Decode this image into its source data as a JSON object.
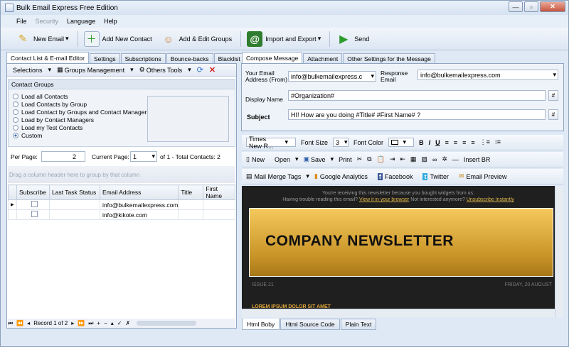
{
  "window": {
    "title": "Bulk Email Express Free Edition",
    "minimize": "—",
    "maximize": "▫",
    "close": "✕"
  },
  "menu": {
    "file": "File",
    "security": "Security",
    "language": "Language",
    "help": "Help"
  },
  "toolbar": {
    "new_email": "New Email",
    "add_contact": "Add New Contact",
    "add_groups": "Add & Edit Groups",
    "import_export": "Import and Export",
    "send": "Send"
  },
  "left_tabs": [
    "Contact List & E-mail Editor",
    "Settings",
    "Subscriptions",
    "Bounce-backs",
    "Blacklist"
  ],
  "left_subbar": {
    "selections": "Selections",
    "groups_mgmt": "Groups Management",
    "others_tools": "Others Tools"
  },
  "groups": {
    "title": "Contact Groups",
    "options": [
      "Load all Contacts",
      "Load Contacts by Group",
      "Load Contact by Groups and Contact Managers",
      "Load by Contact Managers",
      "Load my Test Contacts",
      "Custom"
    ],
    "selected": "Custom"
  },
  "paging": {
    "per_page_label": "Per Page:",
    "per_page": "2",
    "current_label": "Current Page:",
    "current": "1",
    "total": "of 1 - Total Contacts: 2"
  },
  "grid": {
    "drag_hint": "Drag a column header here to group by that column",
    "columns": [
      "Subscribe",
      "Last Task Status",
      "Email Address",
      "Title",
      "First Name"
    ],
    "rows": [
      {
        "email": "info@bulkemailexpress.com"
      },
      {
        "email": "info@kikote.com"
      }
    ]
  },
  "navigator": {
    "record": "Record 1 of 2"
  },
  "right_tabs": [
    "Compose Message",
    "Attachment",
    "Other Settings for the Message"
  ],
  "compose": {
    "from_label": "Your Email Address (From)",
    "from_value": "info@bulkemailexpress.c",
    "response_label": "Response Email",
    "response_value": "info@bulkemailexpress.com",
    "display_label": "Display Name",
    "display_value": "#Organization#",
    "subject_label": "Subject",
    "subject_value": "HI! How are you doing #Title# #First Name#  ?",
    "hash": "#"
  },
  "editor_toolbar1": {
    "font": "Times New R...",
    "font_size_label": "Font Size",
    "font_size": "3",
    "font_color_label": "Font Color"
  },
  "editor_toolbar2": {
    "new": "New",
    "open": "Open",
    "save": "Save",
    "print": "Print",
    "insert_br": "Insert BR"
  },
  "editor_toolbar3": {
    "mail_merge": "Mail Merge Tags",
    "google": "Google Analytics",
    "facebook": "Facebook",
    "twitter": "Twitter",
    "preview": "Email Preview"
  },
  "newsletter": {
    "line1": "You're receiving this newsletter because you bought widgets from us.",
    "line2a": "Having trouble reading this email?",
    "view_link": "View it in your browser",
    "line2b": "Not interested anymore?",
    "unsub_link": "Unsubscribe Instantly",
    "banner": "COMPANY NEWSLETTER",
    "issue": "ISSUE 21",
    "date": "FRIDAY, 20 AUGUST",
    "lorem": "LOREM IPSUM DOLOR SIT AMET"
  },
  "bottom_tabs": [
    "Html Boby",
    "Html Source Code",
    "Plain Text"
  ]
}
